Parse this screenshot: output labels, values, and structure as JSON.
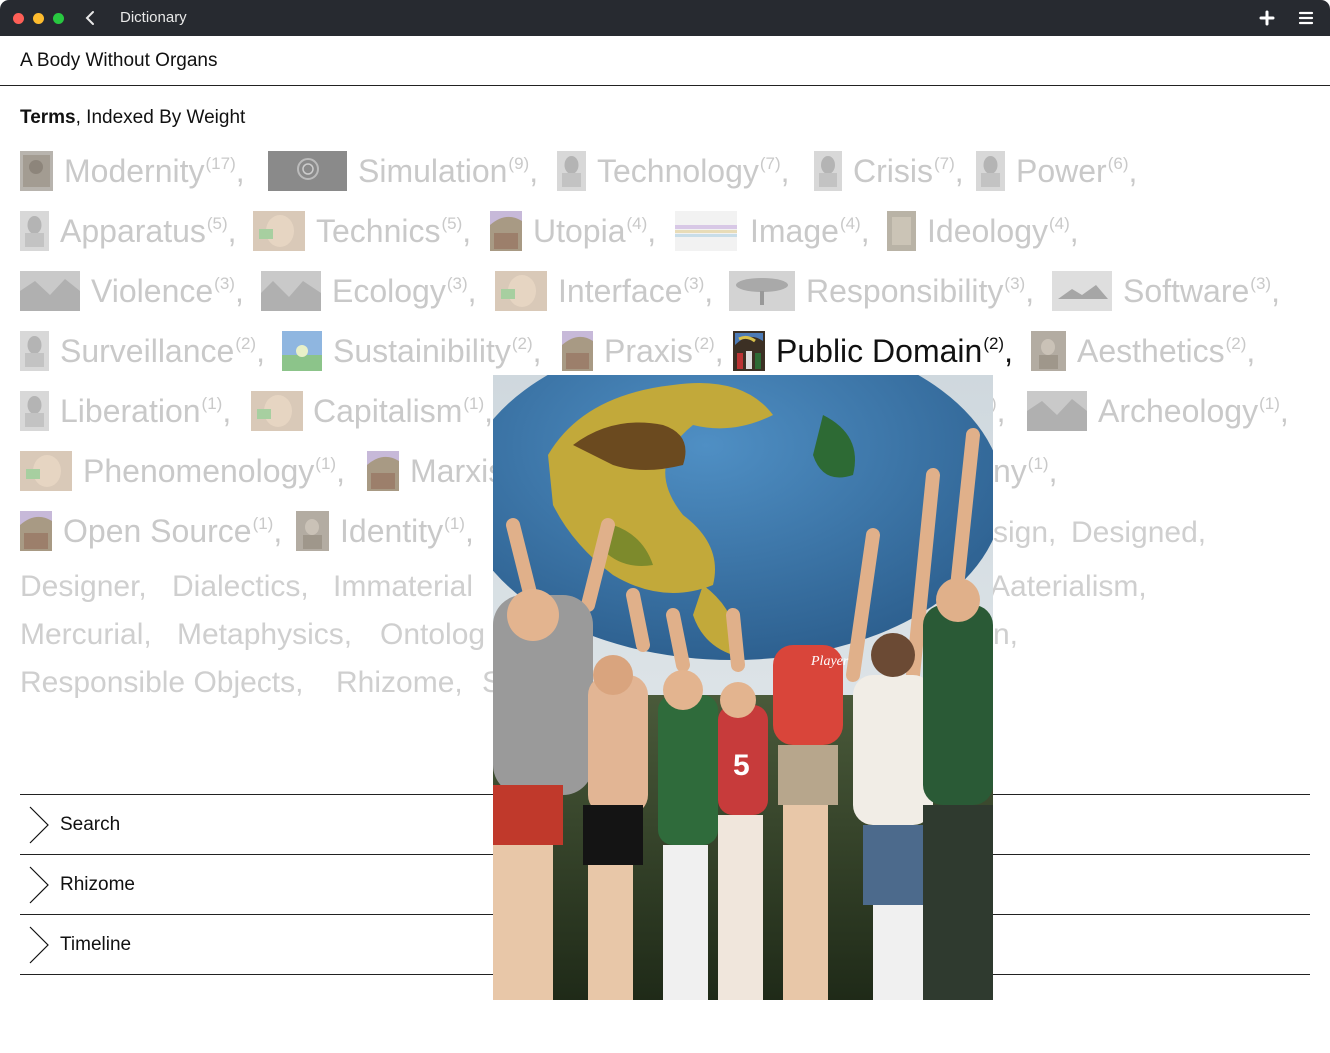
{
  "window": {
    "title": "Dictionary"
  },
  "toolbar": {
    "back_icon": "chevron-left-icon",
    "add_icon": "plus-icon",
    "menu_icon": "hamburger-menu-icon"
  },
  "app": {
    "title": "A Body Without Organs"
  },
  "section": {
    "heading_bold": "Terms",
    "heading_rest": ", Indexed By Weight"
  },
  "terms": [
    {
      "label": "Modernity",
      "count": "(17)",
      "sep": ","
    },
    {
      "label": "Simulation",
      "count": "(9)",
      "sep": ","
    },
    {
      "label": "Technology",
      "count": "(7)",
      "sep": ","
    },
    {
      "label": "Crisis",
      "count": "(7)",
      "sep": ","
    },
    {
      "label": "Power",
      "count": "(6)",
      "sep": ","
    },
    {
      "label": "Apparatus",
      "count": "(5)",
      "sep": ","
    },
    {
      "label": "Technics",
      "count": "(5)",
      "sep": ","
    },
    {
      "label": "Utopia",
      "count": "(4)",
      "sep": ","
    },
    {
      "label": "Image",
      "count": "(4)",
      "sep": ","
    },
    {
      "label": "Ideology",
      "count": "(4)",
      "sep": ","
    },
    {
      "label": "Violence",
      "count": "(3)",
      "sep": ","
    },
    {
      "label": "Ecology",
      "count": "(3)",
      "sep": ","
    },
    {
      "label": "Interface",
      "count": "(3)",
      "sep": ","
    },
    {
      "label": "Responsibility",
      "count": "(3)",
      "sep": ","
    },
    {
      "label": "Software",
      "count": "(3)",
      "sep": ","
    },
    {
      "label": "Surveillance",
      "count": "(2)",
      "sep": ","
    },
    {
      "label": "Sustainibility",
      "count": "(2)",
      "sep": ","
    },
    {
      "label": "Praxis",
      "count": "(2)",
      "sep": ","
    },
    {
      "label": "Public Domain",
      "count": "(2)",
      "sep": ","
    },
    {
      "label": "Aesthetics",
      "count": "(2)",
      "sep": ","
    },
    {
      "label": "Liberation",
      "count": "(1)",
      "sep": ","
    },
    {
      "label": "Capitalism",
      "count": "(1)",
      "sep": ","
    },
    {
      "label": "",
      "count": ")",
      "sep": ","
    },
    {
      "label": "Archeology",
      "count": "(1)",
      "sep": ","
    },
    {
      "label": "Phenomenology",
      "count": "(1)",
      "sep": ","
    },
    {
      "label": "Marxis",
      "count": "",
      "sep": ""
    },
    {
      "label": "ny",
      "count": "(1)",
      "sep": ","
    },
    {
      "label": "Open Source",
      "count": "(1)",
      "sep": ","
    },
    {
      "label": "Identity",
      "count": "(1)",
      "sep": ","
    }
  ],
  "unweighted_terms": [
    "sign,",
    "Designed,",
    "Designer,",
    "Dialectics,",
    "Immaterial",
    "Aaterialism,",
    "Mercurial,",
    "Metaphysics,",
    "Ontolog",
    "n,",
    "Responsible Objects,",
    "Rhizome,",
    "S"
  ],
  "accordion": [
    {
      "label": "Search",
      "icon": "chevron-right-icon"
    },
    {
      "label": "Rhizome",
      "icon": "chevron-right-icon"
    },
    {
      "label": "Timeline",
      "icon": "chevron-right-icon"
    }
  ],
  "active_term": "Public Domain",
  "preview": {
    "subject": "children lifting a giant inflatable earth globe",
    "ball_text": "Player"
  }
}
